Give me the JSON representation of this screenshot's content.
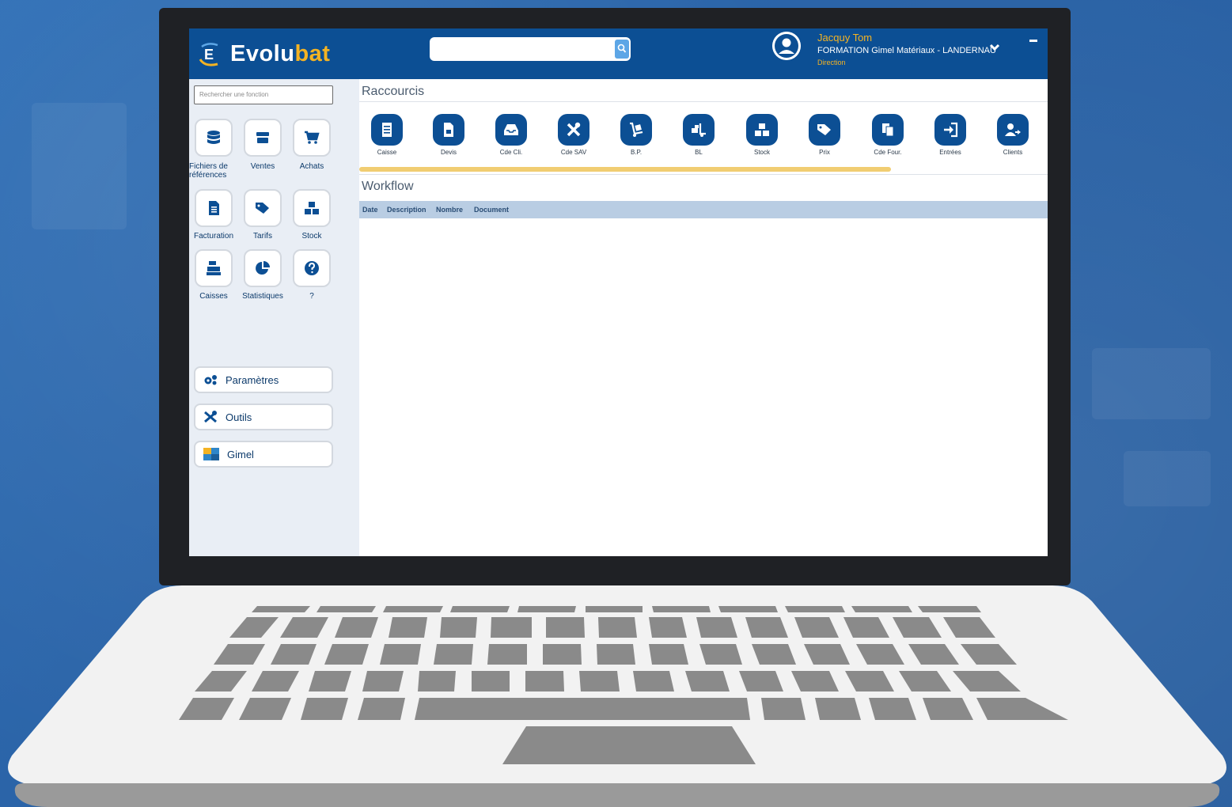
{
  "app": {
    "brand_prefix": "Evolu",
    "brand_suffix": "bat",
    "logo_letter": "E",
    "colors": {
      "primary": "#0c4f94",
      "accent": "#f4b323",
      "shortcut_bar": "#f1cd72",
      "table_header": "#b9cde3"
    }
  },
  "header": {
    "search": {
      "value": "",
      "icon": "search-icon"
    },
    "user": {
      "name": "Jacquy Tom",
      "company": "FORMATION Gimel Matériaux - LANDERNAU",
      "role": "Direction"
    }
  },
  "sidebar": {
    "search_placeholder": "Rechercher une fonction",
    "tiles": [
      {
        "label": "Fichiers de références",
        "icon": "database-icon"
      },
      {
        "label": "Ventes",
        "icon": "store-icon"
      },
      {
        "label": "Achats",
        "icon": "cart-icon"
      },
      {
        "label": "Facturation",
        "icon": "invoice-icon"
      },
      {
        "label": "Tarifs",
        "icon": "tag-icon"
      },
      {
        "label": "Stock",
        "icon": "boxes-icon"
      },
      {
        "label": "Caisses",
        "icon": "cash-register-icon"
      },
      {
        "label": "Statistiques",
        "icon": "pie-chart-icon"
      },
      {
        "label": "?",
        "icon": "help-icon"
      }
    ],
    "buttons": [
      {
        "label": "Paramètres",
        "icon": "cogs-icon"
      },
      {
        "label": "Outils",
        "icon": "tools-icon"
      },
      {
        "label": "Gimel",
        "icon": "gimel-logo-icon"
      }
    ]
  },
  "main": {
    "shortcuts_title": "Raccourcis",
    "shortcuts": [
      {
        "label": "Caisse",
        "icon": "receipt-icon"
      },
      {
        "label": "Devis",
        "icon": "document-icon"
      },
      {
        "label": "Cde Cli.",
        "icon": "inbox-icon"
      },
      {
        "label": "Cde SAV",
        "icon": "tools-icon"
      },
      {
        "label": "B.P.",
        "icon": "dolly-icon"
      },
      {
        "label": "BL",
        "icon": "truck-loading-icon"
      },
      {
        "label": "Stock",
        "icon": "boxes-icon"
      },
      {
        "label": "Prix",
        "icon": "tag-icon"
      },
      {
        "label": "Cde Four.",
        "icon": "copy-icon"
      },
      {
        "label": "Entrées",
        "icon": "sign-in-icon"
      },
      {
        "label": "Clients",
        "icon": "user-arrow-icon"
      }
    ],
    "workflow_title": "Workflow",
    "workflow_columns": [
      "Date",
      "Description",
      "Nombre",
      "Document"
    ]
  }
}
